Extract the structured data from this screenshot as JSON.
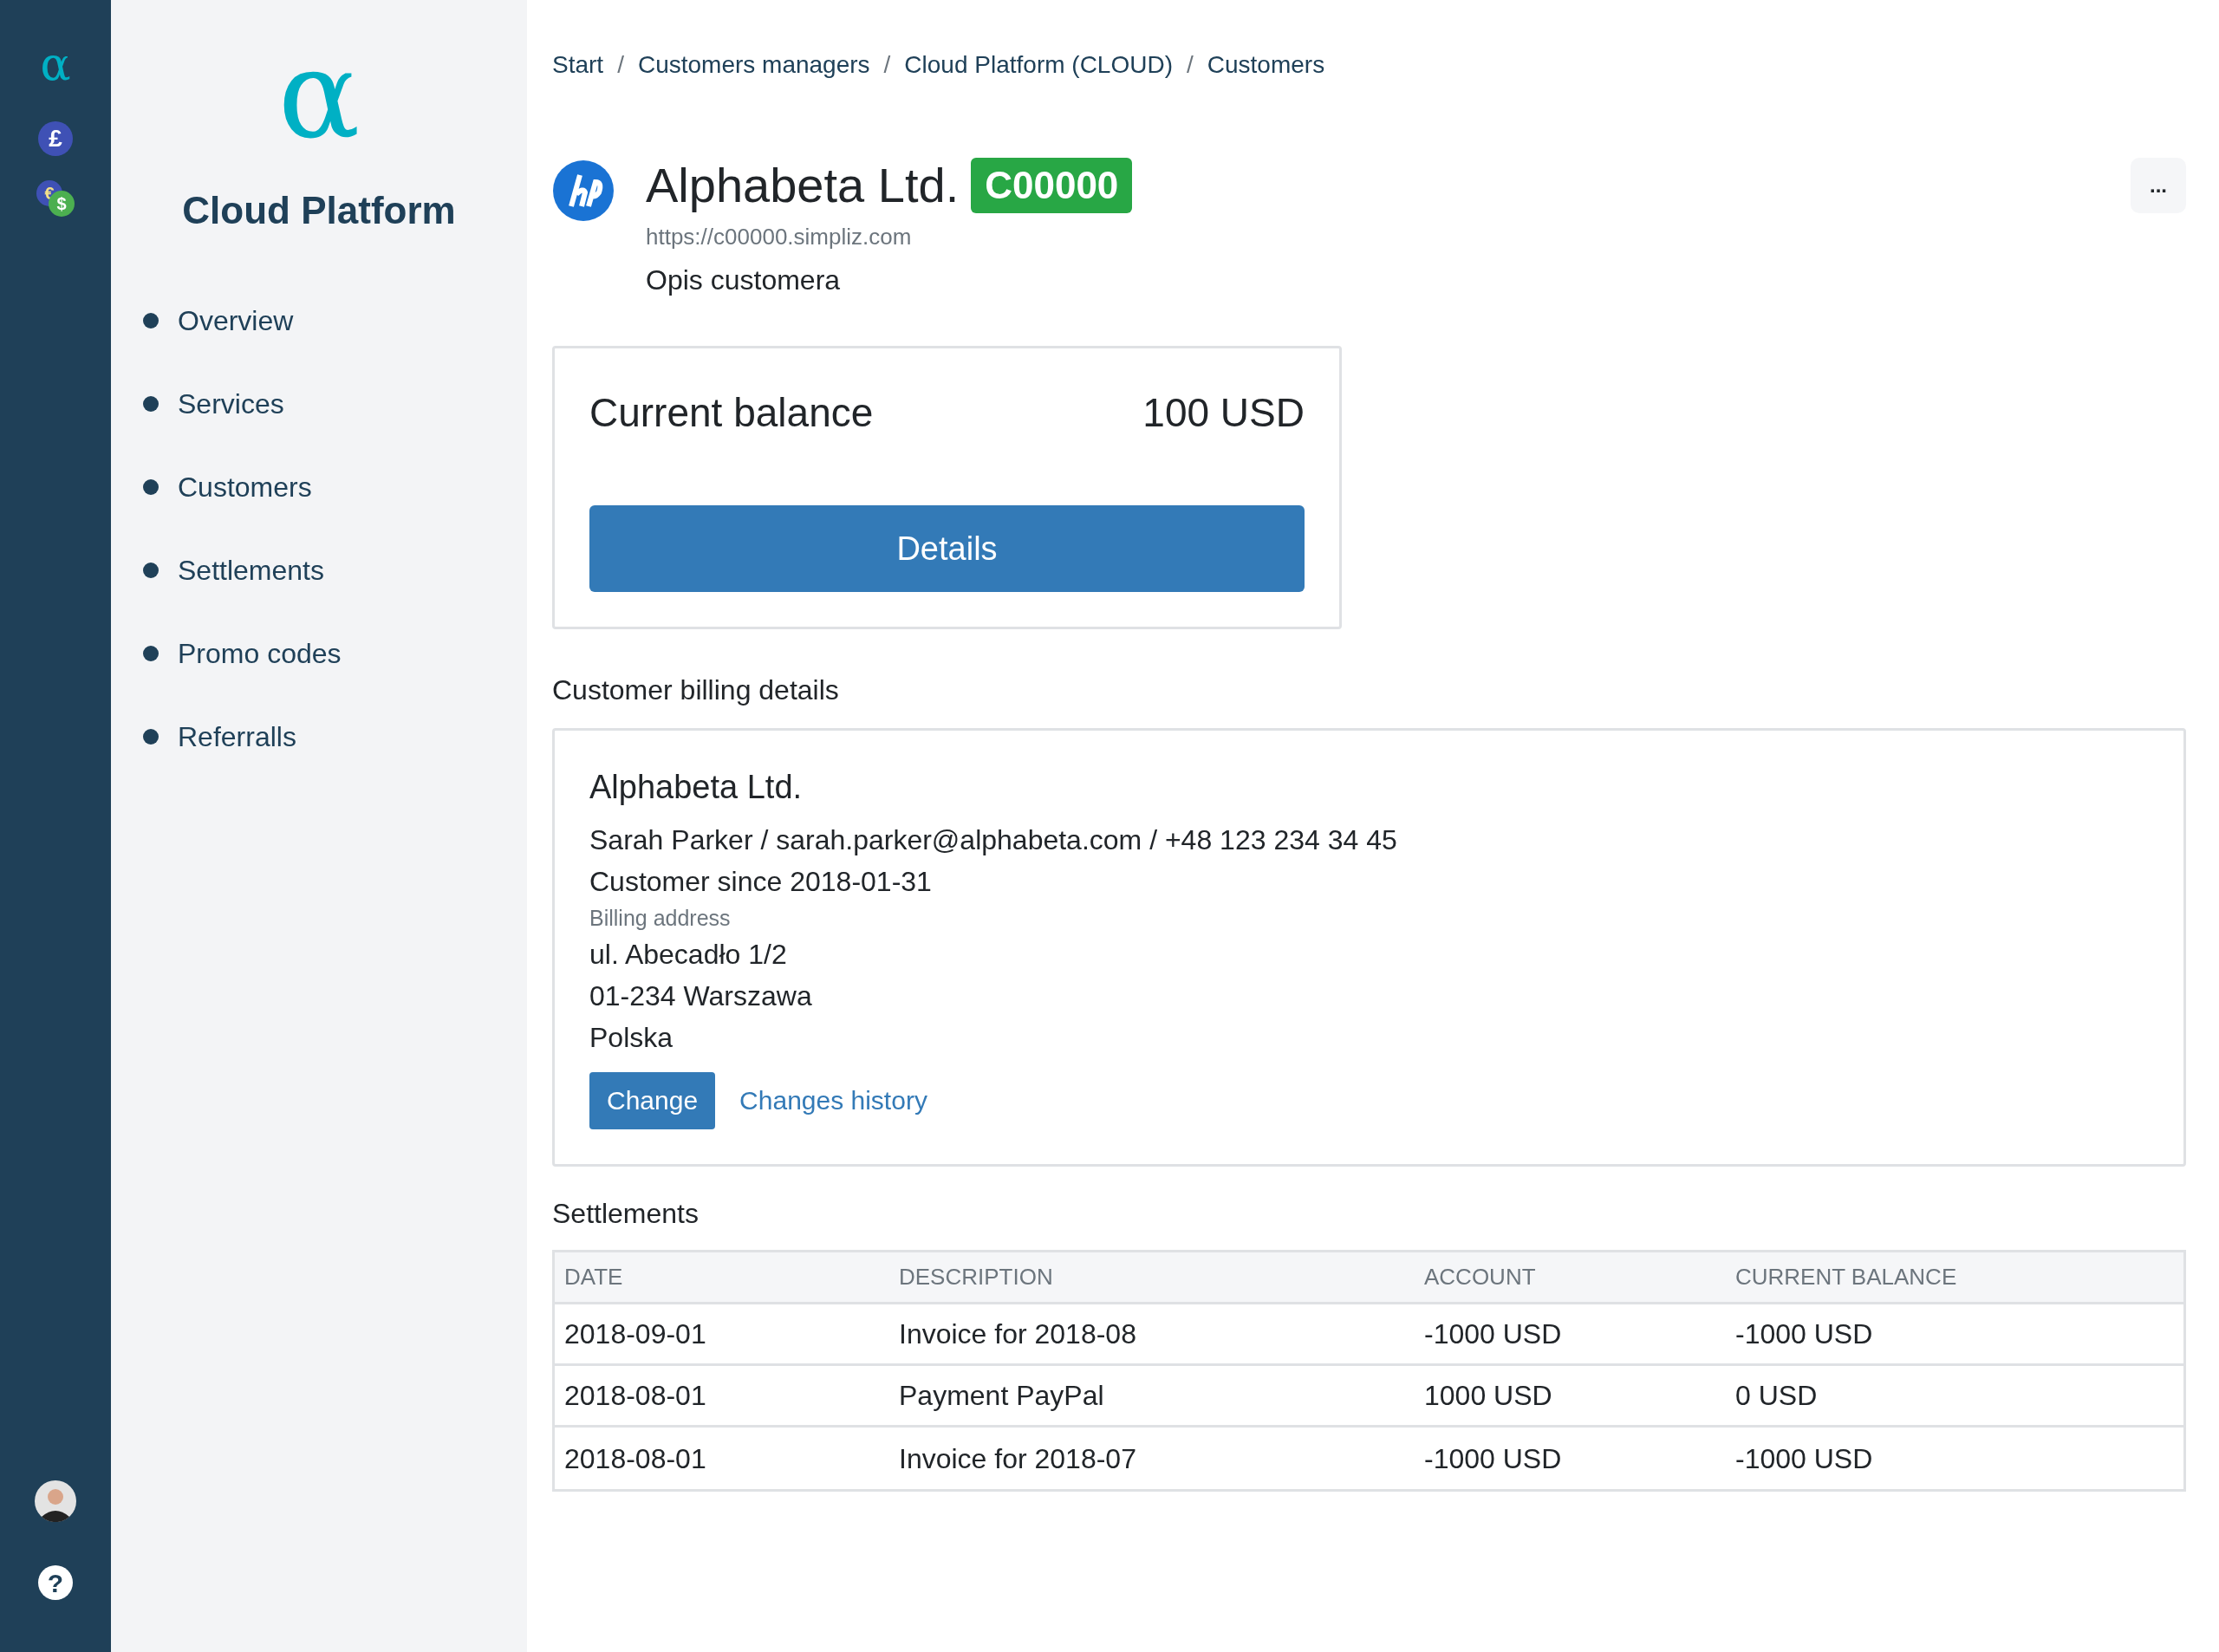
{
  "rail": {
    "logo": "α",
    "pound": "£",
    "euro": "€",
    "dollar": "$",
    "help": "?"
  },
  "sidebar": {
    "logo": "α",
    "title": "Cloud Platform",
    "items": [
      {
        "label": "Overview"
      },
      {
        "label": "Services"
      },
      {
        "label": "Customers"
      },
      {
        "label": "Settlements"
      },
      {
        "label": "Promo codes"
      },
      {
        "label": "Referralls"
      }
    ]
  },
  "breadcrumb": {
    "separator": "/",
    "items": [
      "Start",
      "Customers managers",
      "Cloud Platform (CLOUD)",
      "Customers"
    ]
  },
  "header": {
    "title": "Alphabeta Ltd.",
    "badge": "C00000",
    "url": "https://c00000.simpliz.com",
    "description": "Opis customera",
    "menu": "..."
  },
  "balance": {
    "label": "Current balance",
    "value": "100 USD",
    "button": "Details"
  },
  "billing": {
    "heading": "Customer billing details",
    "company": "Alphabeta Ltd.",
    "contact": "Sarah Parker / sarah.parker@alphabeta.com / +48 123 234 34 45",
    "since": "Customer since 2018-01-31",
    "address_label": "Billing address",
    "address": [
      "ul. Abecadło 1/2",
      "01-234 Warszawa",
      "Polska"
    ],
    "change_button": "Change",
    "history_link": "Changes history"
  },
  "settlements": {
    "heading": "Settlements",
    "columns": [
      "DATE",
      "DESCRIPTION",
      "ACCOUNT",
      "CURRENT BALANCE"
    ],
    "rows": [
      [
        "2018-09-01",
        "Invoice for 2018-08",
        "-1000 USD",
        "-1000 USD"
      ],
      [
        "2018-08-01",
        "Payment PayPal",
        "1000 USD",
        "0 USD"
      ],
      [
        "2018-08-01",
        "Invoice for 2018-07",
        "-1000 USD",
        "-1000 USD"
      ]
    ]
  }
}
